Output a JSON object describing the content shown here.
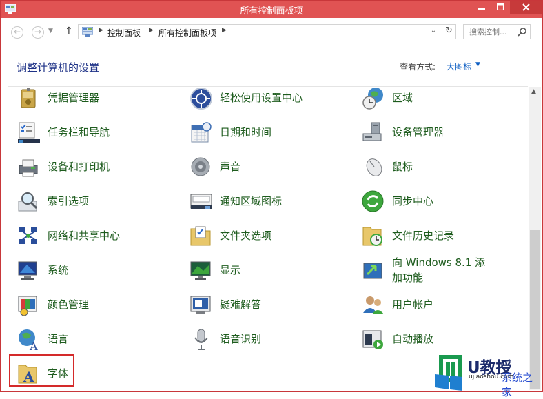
{
  "window": {
    "title": "所有控制面板项",
    "colors": {
      "titlebar": "#e05353",
      "link": "#1e5c1e",
      "heading": "#1e3287",
      "accent": "#0f5fc3"
    }
  },
  "nav": {
    "breadcrumb": [
      "控制面板",
      "所有控制面板项"
    ],
    "search_placeholder": "搜索控制...",
    "icons": [
      "back-arrow-icon",
      "forward-arrow-icon",
      "up-arrow-icon",
      "refresh-icon",
      "search-icon"
    ]
  },
  "header": {
    "heading": "调整计算机的设置",
    "view_by_label": "查看方式:",
    "view_by_value": "大图标"
  },
  "items": [
    {
      "label": "凭据管理器",
      "icon": "credential-manager-icon"
    },
    {
      "label": "轻松使用设置中心",
      "icon": "ease-of-access-icon"
    },
    {
      "label": "区域",
      "icon": "region-globe-icon"
    },
    {
      "label": "任务栏和导航",
      "icon": "taskbar-icon"
    },
    {
      "label": "日期和时间",
      "icon": "calendar-clock-icon"
    },
    {
      "label": "设备管理器",
      "icon": "device-manager-icon"
    },
    {
      "label": "设备和打印机",
      "icon": "printer-icon"
    },
    {
      "label": "声音",
      "icon": "speaker-icon"
    },
    {
      "label": "鼠标",
      "icon": "mouse-icon"
    },
    {
      "label": "索引选项",
      "icon": "indexing-magnifier-icon"
    },
    {
      "label": "通知区域图标",
      "icon": "notification-tray-icon"
    },
    {
      "label": "同步中心",
      "icon": "sync-center-icon"
    },
    {
      "label": "网络和共享中心",
      "icon": "network-icon"
    },
    {
      "label": "文件夹选项",
      "icon": "folder-options-icon"
    },
    {
      "label": "文件历史记录",
      "icon": "file-history-icon"
    },
    {
      "label": "系统",
      "icon": "system-monitor-icon"
    },
    {
      "label": "显示",
      "icon": "display-monitor-icon"
    },
    {
      "label": "向 Windows 8.1 添加功能",
      "icon": "add-features-icon"
    },
    {
      "label": "颜色管理",
      "icon": "color-management-icon"
    },
    {
      "label": "疑难解答",
      "icon": "troubleshooting-icon"
    },
    {
      "label": "用户帐户",
      "icon": "user-accounts-icon"
    },
    {
      "label": "语言",
      "icon": "language-icon"
    },
    {
      "label": "语音识别",
      "icon": "microphone-icon"
    },
    {
      "label": "自动播放",
      "icon": "autoplay-icon"
    },
    {
      "label": "字体",
      "icon": "fonts-folder-icon"
    }
  ],
  "watermark": {
    "brand": "U教授",
    "sub": "ujiaoshou.com",
    "site": "系统之家"
  }
}
